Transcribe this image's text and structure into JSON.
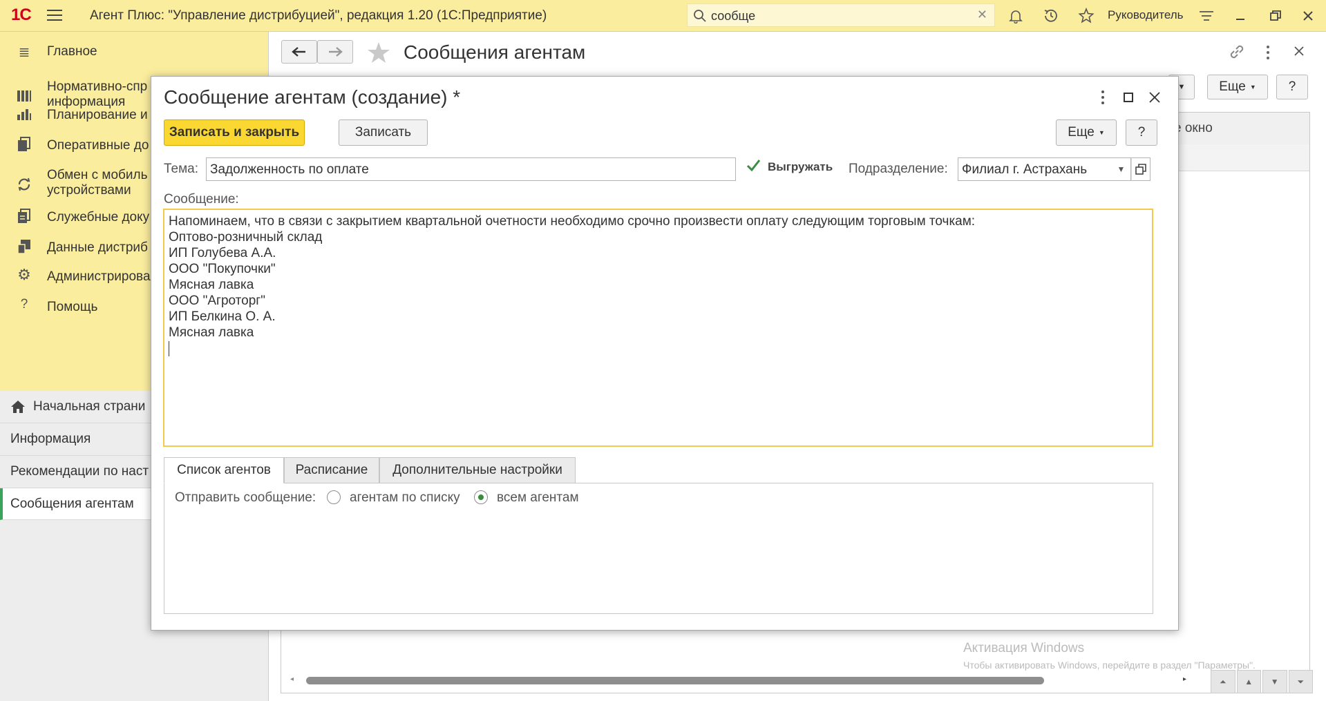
{
  "topbar": {
    "logo": "1С",
    "app_title": "Агент Плюс: \"Управление дистрибуцией\", редакция 1.20  (1С:Предприятие)",
    "search_value": "сообще",
    "user_name": "Руководитель"
  },
  "sidebar": {
    "items": [
      {
        "label": "Главное",
        "icon": "list-icon"
      },
      {
        "label": "Нормативно-спр",
        "label2": "информация",
        "icon": "catalog-icon"
      },
      {
        "label": "Планирование и",
        "icon": "bar-chart-icon"
      },
      {
        "label": "Оперативные до",
        "icon": "documents-icon"
      },
      {
        "label": "Обмен с мобиль",
        "label2": "устройствами",
        "icon": "sync-icon"
      },
      {
        "label": "Служебные доку",
        "icon": "service-documents-icon"
      },
      {
        "label": "Данные дистриб",
        "icon": "data-icon"
      },
      {
        "label": "Администрирова",
        "icon": "gear-icon"
      },
      {
        "label": "Помощь",
        "icon": "help-icon"
      }
    ],
    "open_windows": [
      {
        "label": "Начальная страни",
        "icon": "home-icon"
      },
      {
        "label": "Информация"
      },
      {
        "label": "Рекомендации по наст"
      },
      {
        "label": "Сообщения агентам"
      }
    ]
  },
  "background_window": {
    "title": "Сообщения агентам",
    "more_label": "Еще",
    "help_label": "?",
    "header_partial": "е окно",
    "watermark_title": "Активация Windows",
    "watermark_text": "Чтобы активировать Windows, перейдите в раздел \"Параметры\"."
  },
  "modal": {
    "title": "Сообщение агентам (создание) *",
    "save_close_label": "Записать и закрыть",
    "save_label": "Записать",
    "more_label": "Еще",
    "help_label": "?",
    "topic_label": "Тема:",
    "topic_value": "Задолженность по оплате",
    "export_label": "Выгружать",
    "export_checked": true,
    "division_label": "Подразделение:",
    "division_value": "Филиал г. Астрахань",
    "message_label": "Сообщение:",
    "message_lines": [
      "Напоминаем, что в связи с закрытием квартальной очетности необходимо срочно произвести оплату следующим торговым точкам:",
      "Оптово-розничный склад",
      "ИП Голубева А.А.",
      "ООО \"Покупочки\"",
      "Мясная лавка",
      "ООО \"Агроторг\"",
      "ИП Белкина О. А.",
      "Мясная лавка"
    ],
    "tabs": [
      "Список агентов",
      "Расписание",
      "Дополнительные настройки"
    ],
    "active_tab": 0,
    "send_label": "Отправить сообщение:",
    "radio_options": [
      "агентам по списку",
      "всем агентам"
    ],
    "radio_selected": 1
  },
  "colors": {
    "panel_yellow": "#FBED9E",
    "primary_button": "#FBD732",
    "focus_border": "#F5C84E",
    "accent_green": "#3aa55a"
  }
}
